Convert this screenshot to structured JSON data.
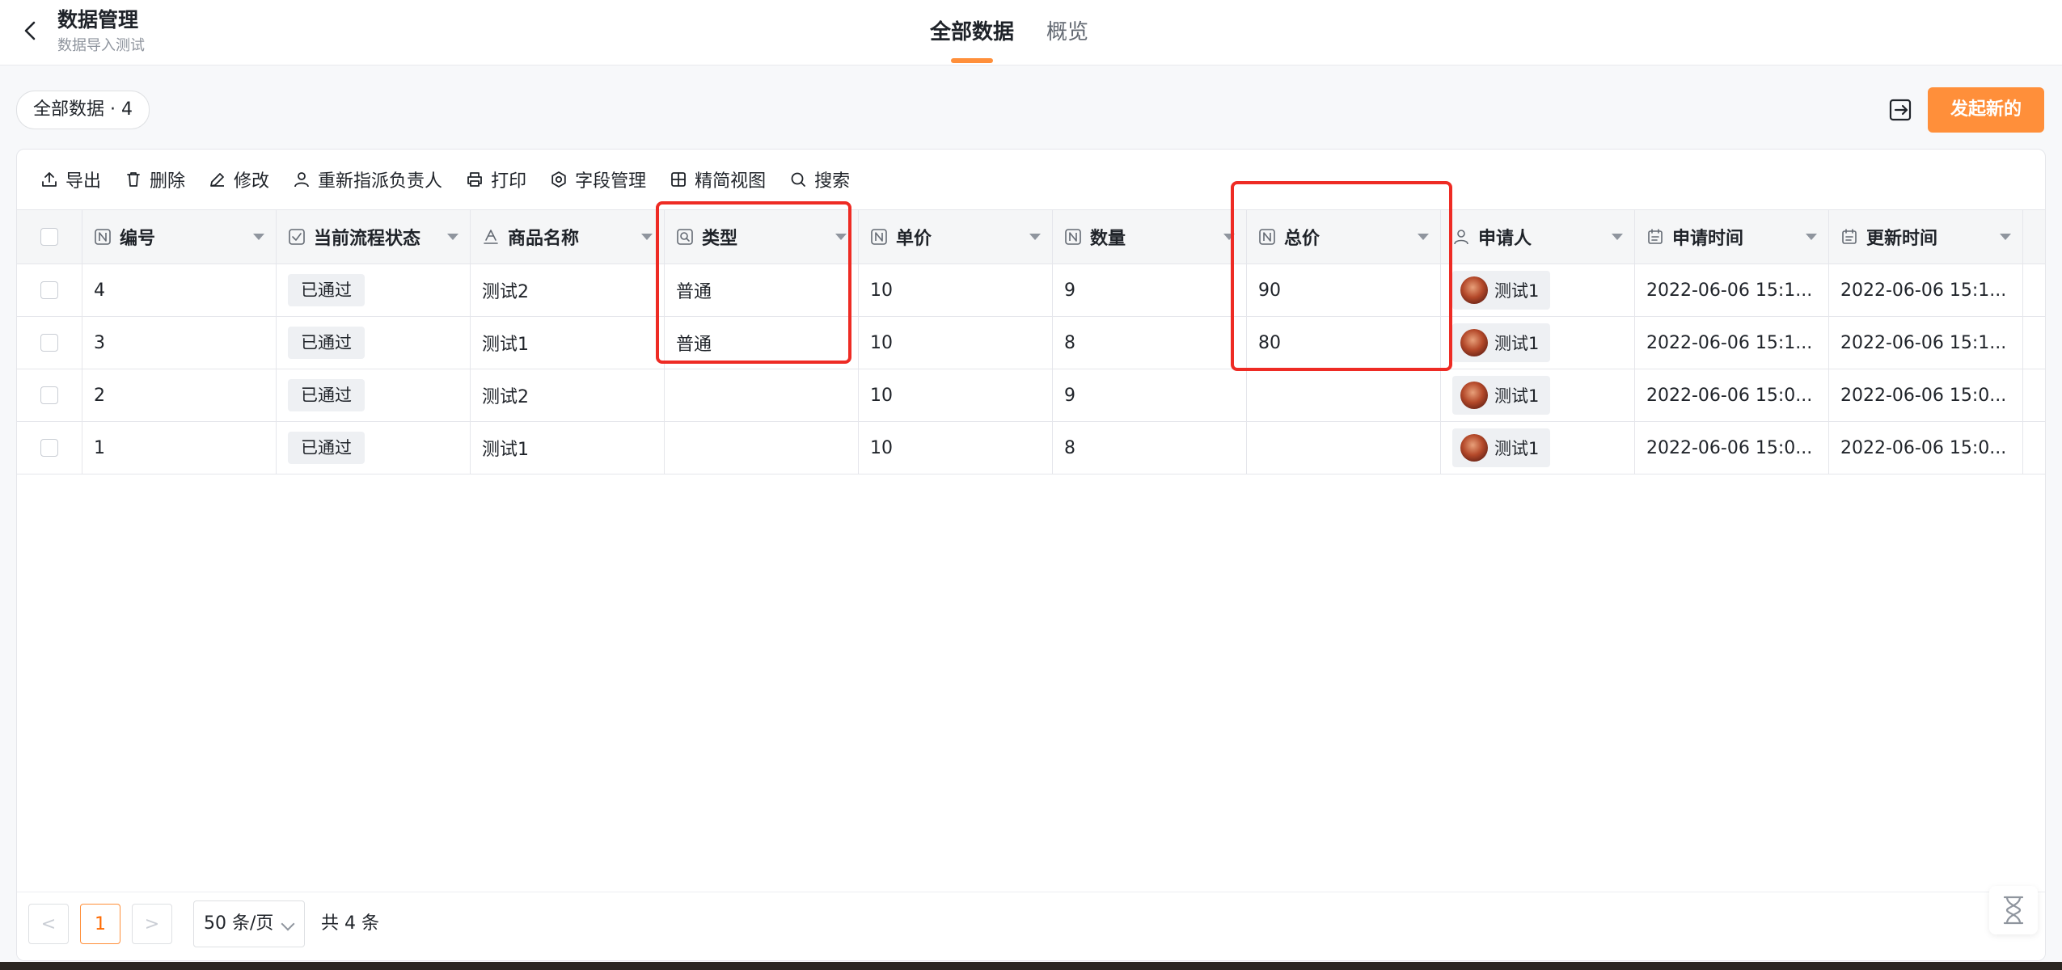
{
  "header": {
    "title": "数据管理",
    "subtitle": "数据导入测试",
    "tabs": [
      {
        "label": "全部数据",
        "active": true
      },
      {
        "label": "概览",
        "active": false
      }
    ]
  },
  "toolbar": {
    "count_chip": "全部数据 · 4",
    "new_button": "发起新的",
    "actions": [
      {
        "label": "导出",
        "icon": "upload-icon"
      },
      {
        "label": "删除",
        "icon": "trash-icon"
      },
      {
        "label": "修改",
        "icon": "pencil-icon"
      },
      {
        "label": "重新指派负责人",
        "icon": "person-icon"
      },
      {
        "label": "打印",
        "icon": "printer-icon"
      },
      {
        "label": "字段管理",
        "icon": "gear-icon"
      },
      {
        "label": "精简视图",
        "icon": "grid-icon"
      },
      {
        "label": "搜索",
        "icon": "search-icon"
      }
    ]
  },
  "table": {
    "columns": [
      {
        "label": "编号",
        "icon": "number-field-icon"
      },
      {
        "label": "当前流程状态",
        "icon": "checkbox-field-icon"
      },
      {
        "label": "商品名称",
        "icon": "text-field-icon"
      },
      {
        "label": "类型",
        "icon": "lookup-field-icon"
      },
      {
        "label": "单价",
        "icon": "number-field-icon"
      },
      {
        "label": "数量",
        "icon": "number-field-icon"
      },
      {
        "label": "总价",
        "icon": "number-field-icon"
      },
      {
        "label": "申请人",
        "icon": "person-field-icon"
      },
      {
        "label": "申请时间",
        "icon": "calendar-icon"
      },
      {
        "label": "更新时间",
        "icon": "calendar-icon"
      }
    ],
    "rows": [
      {
        "id": "4",
        "status": "已通过",
        "name": "测试2",
        "type": "普通",
        "price": "10",
        "qty": "9",
        "total": "90",
        "applicant": "测试1",
        "applied": "2022-06-06 15:1...",
        "updated": "2022-06-06 15:1..."
      },
      {
        "id": "3",
        "status": "已通过",
        "name": "测试1",
        "type": "普通",
        "price": "10",
        "qty": "8",
        "total": "80",
        "applicant": "测试1",
        "applied": "2022-06-06 15:1...",
        "updated": "2022-06-06 15:1..."
      },
      {
        "id": "2",
        "status": "已通过",
        "name": "测试2",
        "type": "",
        "price": "10",
        "qty": "9",
        "total": "",
        "applicant": "测试1",
        "applied": "2022-06-06 15:0...",
        "updated": "2022-06-06 15:0..."
      },
      {
        "id": "1",
        "status": "已通过",
        "name": "测试1",
        "type": "",
        "price": "10",
        "qty": "8",
        "total": "",
        "applicant": "测试1",
        "applied": "2022-06-06 15:0...",
        "updated": "2022-06-06 15:0..."
      }
    ]
  },
  "pagination": {
    "prev": "<",
    "current_page": "1",
    "next": ">",
    "page_size": "50 条/页",
    "total": "共 4 条"
  },
  "colors": {
    "accent": "#ff8f3a",
    "highlight": "#ee2b24"
  }
}
